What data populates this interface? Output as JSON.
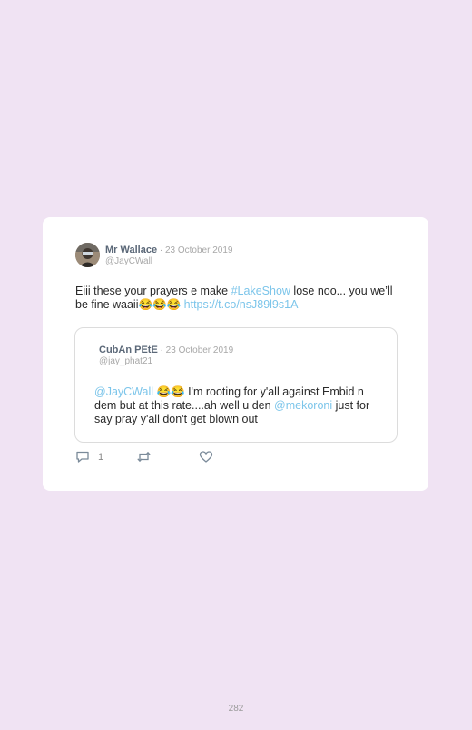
{
  "tweet": {
    "author_name": "Mr Wallace",
    "date": " · 23 October 2019",
    "handle": "@JayCWall",
    "text_part1": "Eiii these your prayers e make ",
    "hashtag": "#LakeShow",
    "text_part2": " lose noo... you we’ll be fine waaii😂😂😂 ",
    "link": "https://t.co/nsJ89l9s1A"
  },
  "quoted_tweet": {
    "author_name": "CubAn PEtE",
    "date": " · 23 October 2019",
    "handle": "@jay_phat21",
    "mention1": "@JayCWall",
    "text_part1": " 😂😂 I'm rooting for y'all against Embid n dem but at this rate....ah well u den ",
    "mention2": "@mekoroni",
    "text_part2": " just for say pray y'all don't get blown out"
  },
  "actions": {
    "reply_count": "1",
    "reply_icon": "reply-icon",
    "retweet_icon": "retweet-icon",
    "like_icon": "heart-icon"
  },
  "colors": {
    "background": "#f0e3f3",
    "link": "#7cc5ea",
    "author": "#5b6878"
  },
  "footer": {
    "page_number": "282"
  }
}
